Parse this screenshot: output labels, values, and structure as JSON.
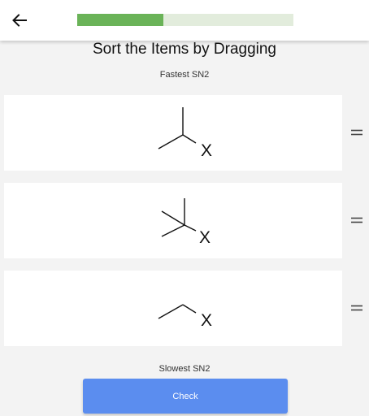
{
  "progress": 0.4,
  "header": {
    "back_icon": "arrow-left-icon"
  },
  "title": "Sort the Items by Dragging",
  "top_label": "Fastest SN2",
  "bottom_label": "Slowest SN2",
  "items": [
    {
      "name": "isopropyl-x",
      "substituent": "X"
    },
    {
      "name": "tert-butyl-x",
      "substituent": "X"
    },
    {
      "name": "ethyl-x",
      "substituent": "X"
    }
  ],
  "drag_handle_icon": "drag-handle-icon",
  "check_button": {
    "label": "Check",
    "color": "#5b8def"
  },
  "colors": {
    "progress_fill": "#6ab358",
    "progress_track": "#e2ecdc"
  }
}
